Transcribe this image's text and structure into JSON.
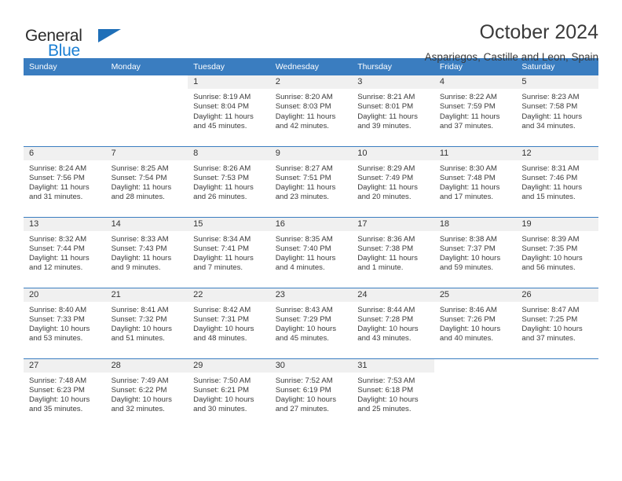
{
  "brand": {
    "name_part1": "General",
    "name_part2": "Blue",
    "triangle_color": "#1f6fb8",
    "blue_color": "#1a7fd4"
  },
  "header": {
    "title": "October 2024",
    "subtitle": "Aspariegos, Castille and Leon, Spain"
  },
  "theme": {
    "header_blue": "#3a7dc0",
    "daynum_band": "#f0f0f0",
    "text": "#3b3b3b"
  },
  "weekday_headers": [
    "Sunday",
    "Monday",
    "Tuesday",
    "Wednesday",
    "Thursday",
    "Friday",
    "Saturday"
  ],
  "weeks": [
    [
      {
        "day": "",
        "sunrise": "",
        "sunset": "",
        "daylight1": "",
        "daylight2": "",
        "blank": true
      },
      {
        "day": "",
        "sunrise": "",
        "sunset": "",
        "daylight1": "",
        "daylight2": "",
        "blank": true
      },
      {
        "day": "1",
        "sunrise": "Sunrise: 8:19 AM",
        "sunset": "Sunset: 8:04 PM",
        "daylight1": "Daylight: 11 hours",
        "daylight2": "and 45 minutes."
      },
      {
        "day": "2",
        "sunrise": "Sunrise: 8:20 AM",
        "sunset": "Sunset: 8:03 PM",
        "daylight1": "Daylight: 11 hours",
        "daylight2": "and 42 minutes."
      },
      {
        "day": "3",
        "sunrise": "Sunrise: 8:21 AM",
        "sunset": "Sunset: 8:01 PM",
        "daylight1": "Daylight: 11 hours",
        "daylight2": "and 39 minutes."
      },
      {
        "day": "4",
        "sunrise": "Sunrise: 8:22 AM",
        "sunset": "Sunset: 7:59 PM",
        "daylight1": "Daylight: 11 hours",
        "daylight2": "and 37 minutes."
      },
      {
        "day": "5",
        "sunrise": "Sunrise: 8:23 AM",
        "sunset": "Sunset: 7:58 PM",
        "daylight1": "Daylight: 11 hours",
        "daylight2": "and 34 minutes."
      }
    ],
    [
      {
        "day": "6",
        "sunrise": "Sunrise: 8:24 AM",
        "sunset": "Sunset: 7:56 PM",
        "daylight1": "Daylight: 11 hours",
        "daylight2": "and 31 minutes."
      },
      {
        "day": "7",
        "sunrise": "Sunrise: 8:25 AM",
        "sunset": "Sunset: 7:54 PM",
        "daylight1": "Daylight: 11 hours",
        "daylight2": "and 28 minutes."
      },
      {
        "day": "8",
        "sunrise": "Sunrise: 8:26 AM",
        "sunset": "Sunset: 7:53 PM",
        "daylight1": "Daylight: 11 hours",
        "daylight2": "and 26 minutes."
      },
      {
        "day": "9",
        "sunrise": "Sunrise: 8:27 AM",
        "sunset": "Sunset: 7:51 PM",
        "daylight1": "Daylight: 11 hours",
        "daylight2": "and 23 minutes."
      },
      {
        "day": "10",
        "sunrise": "Sunrise: 8:29 AM",
        "sunset": "Sunset: 7:49 PM",
        "daylight1": "Daylight: 11 hours",
        "daylight2": "and 20 minutes."
      },
      {
        "day": "11",
        "sunrise": "Sunrise: 8:30 AM",
        "sunset": "Sunset: 7:48 PM",
        "daylight1": "Daylight: 11 hours",
        "daylight2": "and 17 minutes."
      },
      {
        "day": "12",
        "sunrise": "Sunrise: 8:31 AM",
        "sunset": "Sunset: 7:46 PM",
        "daylight1": "Daylight: 11 hours",
        "daylight2": "and 15 minutes."
      }
    ],
    [
      {
        "day": "13",
        "sunrise": "Sunrise: 8:32 AM",
        "sunset": "Sunset: 7:44 PM",
        "daylight1": "Daylight: 11 hours",
        "daylight2": "and 12 minutes."
      },
      {
        "day": "14",
        "sunrise": "Sunrise: 8:33 AM",
        "sunset": "Sunset: 7:43 PM",
        "daylight1": "Daylight: 11 hours",
        "daylight2": "and 9 minutes."
      },
      {
        "day": "15",
        "sunrise": "Sunrise: 8:34 AM",
        "sunset": "Sunset: 7:41 PM",
        "daylight1": "Daylight: 11 hours",
        "daylight2": "and 7 minutes."
      },
      {
        "day": "16",
        "sunrise": "Sunrise: 8:35 AM",
        "sunset": "Sunset: 7:40 PM",
        "daylight1": "Daylight: 11 hours",
        "daylight2": "and 4 minutes."
      },
      {
        "day": "17",
        "sunrise": "Sunrise: 8:36 AM",
        "sunset": "Sunset: 7:38 PM",
        "daylight1": "Daylight: 11 hours",
        "daylight2": "and 1 minute."
      },
      {
        "day": "18",
        "sunrise": "Sunrise: 8:38 AM",
        "sunset": "Sunset: 7:37 PM",
        "daylight1": "Daylight: 10 hours",
        "daylight2": "and 59 minutes."
      },
      {
        "day": "19",
        "sunrise": "Sunrise: 8:39 AM",
        "sunset": "Sunset: 7:35 PM",
        "daylight1": "Daylight: 10 hours",
        "daylight2": "and 56 minutes."
      }
    ],
    [
      {
        "day": "20",
        "sunrise": "Sunrise: 8:40 AM",
        "sunset": "Sunset: 7:33 PM",
        "daylight1": "Daylight: 10 hours",
        "daylight2": "and 53 minutes."
      },
      {
        "day": "21",
        "sunrise": "Sunrise: 8:41 AM",
        "sunset": "Sunset: 7:32 PM",
        "daylight1": "Daylight: 10 hours",
        "daylight2": "and 51 minutes."
      },
      {
        "day": "22",
        "sunrise": "Sunrise: 8:42 AM",
        "sunset": "Sunset: 7:31 PM",
        "daylight1": "Daylight: 10 hours",
        "daylight2": "and 48 minutes."
      },
      {
        "day": "23",
        "sunrise": "Sunrise: 8:43 AM",
        "sunset": "Sunset: 7:29 PM",
        "daylight1": "Daylight: 10 hours",
        "daylight2": "and 45 minutes."
      },
      {
        "day": "24",
        "sunrise": "Sunrise: 8:44 AM",
        "sunset": "Sunset: 7:28 PM",
        "daylight1": "Daylight: 10 hours",
        "daylight2": "and 43 minutes."
      },
      {
        "day": "25",
        "sunrise": "Sunrise: 8:46 AM",
        "sunset": "Sunset: 7:26 PM",
        "daylight1": "Daylight: 10 hours",
        "daylight2": "and 40 minutes."
      },
      {
        "day": "26",
        "sunrise": "Sunrise: 8:47 AM",
        "sunset": "Sunset: 7:25 PM",
        "daylight1": "Daylight: 10 hours",
        "daylight2": "and 37 minutes."
      }
    ],
    [
      {
        "day": "27",
        "sunrise": "Sunrise: 7:48 AM",
        "sunset": "Sunset: 6:23 PM",
        "daylight1": "Daylight: 10 hours",
        "daylight2": "and 35 minutes."
      },
      {
        "day": "28",
        "sunrise": "Sunrise: 7:49 AM",
        "sunset": "Sunset: 6:22 PM",
        "daylight1": "Daylight: 10 hours",
        "daylight2": "and 32 minutes."
      },
      {
        "day": "29",
        "sunrise": "Sunrise: 7:50 AM",
        "sunset": "Sunset: 6:21 PM",
        "daylight1": "Daylight: 10 hours",
        "daylight2": "and 30 minutes."
      },
      {
        "day": "30",
        "sunrise": "Sunrise: 7:52 AM",
        "sunset": "Sunset: 6:19 PM",
        "daylight1": "Daylight: 10 hours",
        "daylight2": "and 27 minutes."
      },
      {
        "day": "31",
        "sunrise": "Sunrise: 7:53 AM",
        "sunset": "Sunset: 6:18 PM",
        "daylight1": "Daylight: 10 hours",
        "daylight2": "and 25 minutes."
      },
      {
        "day": "",
        "sunrise": "",
        "sunset": "",
        "daylight1": "",
        "daylight2": "",
        "blank": true
      },
      {
        "day": "",
        "sunrise": "",
        "sunset": "",
        "daylight1": "",
        "daylight2": "",
        "blank": true
      }
    ]
  ]
}
